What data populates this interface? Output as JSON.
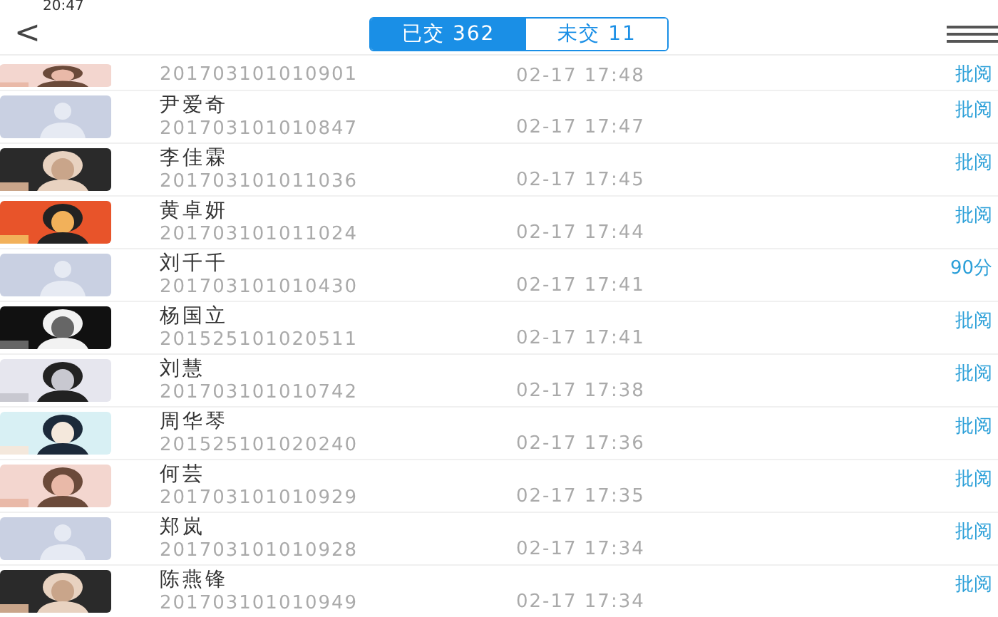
{
  "status_bar": {
    "time": "20:47"
  },
  "header": {
    "back": "<",
    "tabs": [
      {
        "label": "已交 362",
        "selected": true
      },
      {
        "label": "未交 11",
        "selected": false
      }
    ]
  },
  "rows": [
    {
      "kind": "picture",
      "id": "201703101010901",
      "time": "02-17 17:48",
      "action": "批阅"
    },
    {
      "kind": "placeholder",
      "name": "尹爱奇",
      "id": "201703101010847",
      "time": "02-17 17:47",
      "action": "批阅"
    },
    {
      "kind": "picture",
      "name": "李佳霖",
      "id": "201703101011036",
      "time": "02-17 17:45",
      "action": "批阅"
    },
    {
      "kind": "picture",
      "name": "黄卓妍",
      "id": "201703101011024",
      "time": "02-17 17:44",
      "action": "批阅"
    },
    {
      "kind": "placeholder",
      "name": "刘千千",
      "id": "201703101010430",
      "time": "02-17 17:41",
      "action": "90分"
    },
    {
      "kind": "picture",
      "name": "杨国立",
      "id": "201525101020511",
      "time": "02-17 17:41",
      "action": "批阅"
    },
    {
      "kind": "picture",
      "name": "刘慧",
      "id": "201703101010742",
      "time": "02-17 17:38",
      "action": "批阅"
    },
    {
      "kind": "picture",
      "name": "周华琴",
      "id": "201525101020240",
      "time": "02-17 17:36",
      "action": "批阅"
    },
    {
      "kind": "picture",
      "name": "何芸",
      "id": "201703101010929",
      "time": "02-17 17:35",
      "action": "批阅"
    },
    {
      "kind": "placeholder",
      "name": "郑岚",
      "id": "201703101010928",
      "time": "02-17 17:34",
      "action": "批阅"
    },
    {
      "kind": "picture",
      "name": "陈燕锋",
      "id": "201703101010949",
      "time": "02-17 17:34",
      "action": "批阅"
    }
  ]
}
